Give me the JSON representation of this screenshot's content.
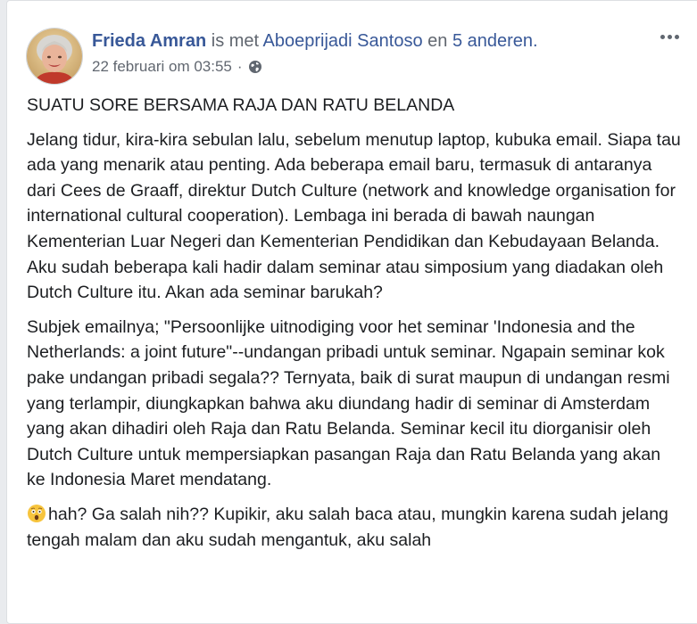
{
  "post": {
    "author": "Frieda Amran",
    "with_text": "is met",
    "tagged_person": "Aboeprijadi Santoso",
    "and_text": "en",
    "others": "5 anderen.",
    "timestamp": "22 februari om 03:55",
    "separator": "·",
    "privacy_icon": "globe-icon",
    "menu_icon": "more-options-icon",
    "title": "SUATU SORE BERSAMA RAJA DAN RATU BELANDA",
    "paragraphs": [
      "Jelang tidur, kira-kira sebulan lalu, sebelum menutup laptop, kubuka email. Siapa tau ada yang menarik atau penting. Ada beberapa email baru, termasuk di antaranya dari Cees de Graaff, direktur Dutch Culture (network and knowledge organisation for international cultural cooperation). Lembaga ini berada di bawah naungan Kementerian Luar Negeri dan Kementerian Pendidikan dan Kebudayaan Belanda. Aku sudah beberapa kali hadir dalam seminar atau simposium yang diadakan oleh Dutch Culture itu. Akan ada seminar barukah?",
      "Subjek emailnya; \"Persoonlijke uitnodiging voor het seminar 'Indonesia and the Netherlands: a joint future\"--undangan pribadi untuk seminar. Ngapain seminar kok pake undangan pribadi segala?? Ternyata, baik di surat maupun di undangan resmi yang terlampir, diungkapkan bahwa aku diundang hadir di seminar di Amsterdam yang akan dihadiri oleh Raja dan Ratu Belanda. Seminar kecil itu diorganisir oleh Dutch Culture untuk mempersiapkan pasangan Raja dan Ratu Belanda yang akan ke Indonesia Maret mendatang."
    ],
    "last_paragraph_emoji": "astonished-face-emoji",
    "last_paragraph": "hah? Ga salah nih?? Kupikir, aku salah baca atau, mungkin karena sudah jelang tengah malam dan aku sudah mengantuk, aku salah"
  },
  "colors": {
    "link": "#385898",
    "meta": "#616770",
    "text": "#1c1e21",
    "background": "#e9ebee",
    "card": "#ffffff"
  }
}
